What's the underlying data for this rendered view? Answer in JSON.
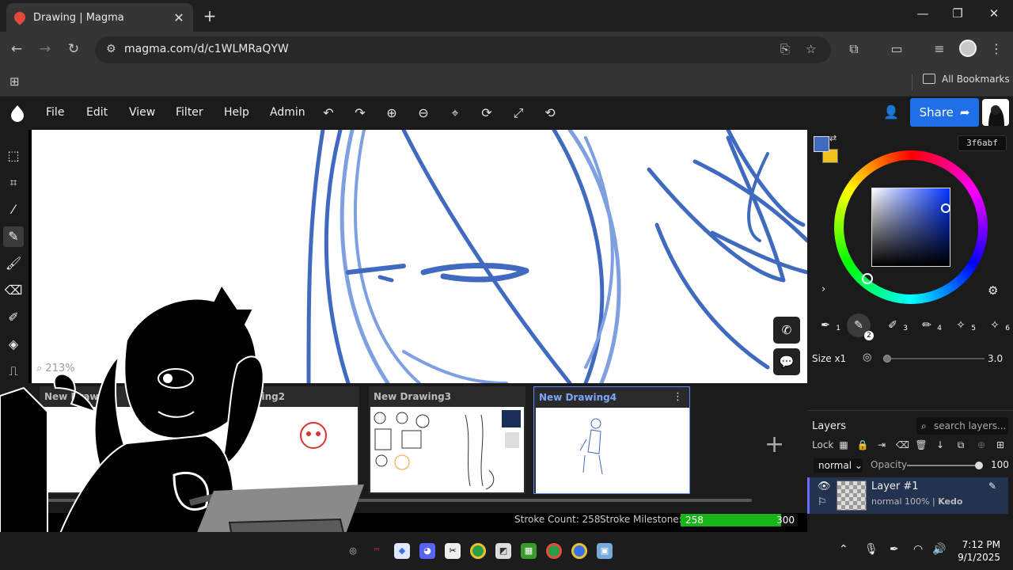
{
  "browser": {
    "tab_title": "Drawing | Magma",
    "url": "magma.com/d/c1WLMRaQYW",
    "bookmarks_label": "All Bookmarks",
    "tab_close": "✕",
    "new_tab": "+"
  },
  "menu": {
    "file": "File",
    "edit": "Edit",
    "view": "View",
    "filter": "Filter",
    "help": "Help",
    "admin": "Admin",
    "share": "Share"
  },
  "canvas": {
    "zoom": "213%",
    "stroke_color": "#3f6abf"
  },
  "color": {
    "primary": "#3f6abf",
    "secondary": "#f2c21b",
    "hex": "3f6abf"
  },
  "brushes": [
    {
      "n": "1",
      "icon": "eyedropper-brush"
    },
    {
      "n": "2",
      "icon": "pencil"
    },
    {
      "n": "3",
      "icon": "pen"
    },
    {
      "n": "4",
      "icon": "marker"
    },
    {
      "n": "5",
      "icon": "sparkle-pen"
    },
    {
      "n": "6",
      "icon": "sparkle-pen"
    }
  ],
  "size": {
    "label": "Size x1",
    "value": "3.0",
    "slider_fraction": 0.0
  },
  "layers": {
    "title": "Layers",
    "search_placeholder": "search layers...",
    "lock_label": "Lock",
    "blend_mode": "normal",
    "opacity_label": "Opacity",
    "opacity_value": "100",
    "layer_name": "Layer #1",
    "layer_meta_mode": "normal 100% |",
    "layer_meta_owner": "Kedo"
  },
  "drawings": [
    {
      "title": "New Drawing",
      "selected": false
    },
    {
      "title": "New Drawing2",
      "selected": false
    },
    {
      "title": "New Drawing3",
      "selected": false
    },
    {
      "title": "New Drawing4",
      "selected": true
    }
  ],
  "stats": {
    "stroke_count_label": "Stroke Count: 258",
    "milestone_label": "Stroke Milestone:",
    "milestone_value": "258",
    "milestone_target": "300",
    "milestone_fraction": 0.86
  },
  "taskbar": {
    "time": "7:12 PM",
    "date": "9/1/2025"
  }
}
